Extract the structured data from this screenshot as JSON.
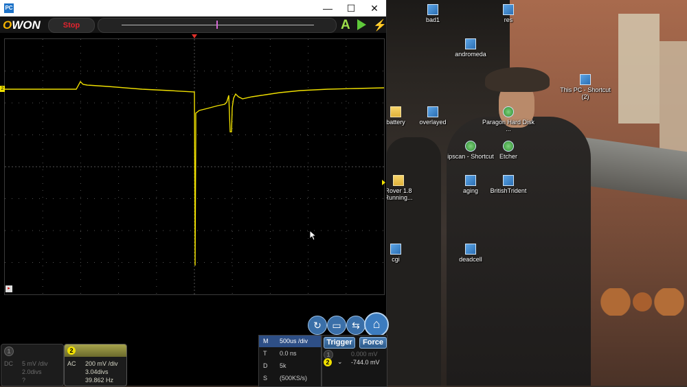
{
  "window": {
    "app_icon": "PC",
    "min_icon": "—",
    "max_icon": "☐",
    "close_icon": "✕"
  },
  "toolbar": {
    "logo_o": "O",
    "logo_rest": "WON",
    "stop_label": "Stop",
    "auto_label": "A"
  },
  "screen": {
    "channel_marker": "2",
    "corner_tag": "▸",
    "trace_color": "#f0e000",
    "grid_color": "#555555"
  },
  "ch1": {
    "badge": "1",
    "coupling": "DC",
    "volts_div": "5 mV /div",
    "offset": "2.0divs",
    "freq": "?"
  },
  "ch2": {
    "badge": "2",
    "coupling": "AC",
    "volts_div": "200 mV /div",
    "offset": "3.04divs",
    "freq": "39.862 Hz"
  },
  "timebase": {
    "rows": [
      {
        "k": "M",
        "v": "500us /div"
      },
      {
        "k": "T",
        "v": "0.0 ns"
      },
      {
        "k": "D",
        "v": "5k"
      },
      {
        "k": "S",
        "v": "(500KS/s)"
      }
    ]
  },
  "trigger": {
    "trigger_label": "Trigger",
    "force_label": "Force",
    "ch1_level": "0.000 mV",
    "ch2_level": "-744.0 mV",
    "ch1_badge": "1",
    "ch2_badge": "2",
    "edge_icon": "⌄"
  },
  "desktop_icons": [
    {
      "label": "bad1"
    },
    {
      "label": "res"
    },
    {
      "label": "andromeda"
    },
    {
      "label": "This PC - Shortcut (2)"
    },
    {
      "label": "battery"
    },
    {
      "label": "overlayed"
    },
    {
      "label": "Paragon Hard Disk ..."
    },
    {
      "label": "ipscan - Shortcut"
    },
    {
      "label": "Etcher"
    },
    {
      "label": "Rover 1.8 Running..."
    },
    {
      "label": "aging"
    },
    {
      "label": "BritishTrident"
    },
    {
      "label": "cgi"
    },
    {
      "label": "deadcell"
    }
  ]
}
